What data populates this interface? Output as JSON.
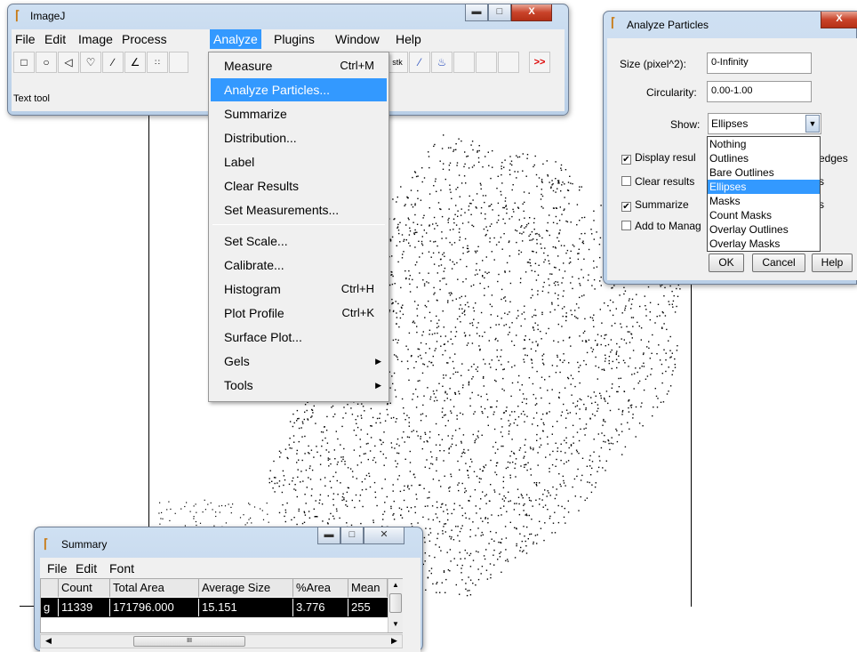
{
  "imagej": {
    "title": "ImageJ",
    "menubar": [
      "File",
      "Edit",
      "Image",
      "Process",
      "Analyze",
      "Plugins",
      "Window",
      "Help"
    ],
    "status": "Text tool",
    "more_tools": ">>"
  },
  "analyze_menu": {
    "items": [
      {
        "label": "Measure",
        "shortcut": "Ctrl+M"
      },
      {
        "label": "Analyze Particles...",
        "shortcut": ""
      },
      {
        "label": "Summarize",
        "shortcut": ""
      },
      {
        "label": "Distribution...",
        "shortcut": ""
      },
      {
        "label": "Label",
        "shortcut": ""
      },
      {
        "label": "Clear Results",
        "shortcut": ""
      },
      {
        "label": "Set Measurements...",
        "shortcut": ""
      },
      {
        "label": "Set Scale...",
        "shortcut": ""
      },
      {
        "label": "Calibrate...",
        "shortcut": ""
      },
      {
        "label": "Histogram",
        "shortcut": "Ctrl+H"
      },
      {
        "label": "Plot Profile",
        "shortcut": "Ctrl+K"
      },
      {
        "label": "Surface Plot...",
        "shortcut": ""
      },
      {
        "label": "Gels",
        "shortcut": ""
      },
      {
        "label": "Tools",
        "shortcut": ""
      }
    ]
  },
  "dialog": {
    "title": "Analyze Particles",
    "size_label": "Size (pixel^2):",
    "size_value": "0-Infinity",
    "circ_label": "Circularity:",
    "circ_value": "0.00-1.00",
    "show_label": "Show:",
    "show_value": "Ellipses",
    "options": [
      "Nothing",
      "Outlines",
      "Bare Outlines",
      "Ellipses",
      "Masks",
      "Count Masks",
      "Overlay Outlines",
      "Overlay Masks"
    ],
    "checks": [
      {
        "label": "Display resul",
        "checked": true
      },
      {
        "label": "Clear results",
        "checked": false
      },
      {
        "label": "Summarize",
        "checked": true
      },
      {
        "label": "Add to Manag",
        "checked": false
      }
    ],
    "right_fragments": [
      "edges",
      "s",
      "s"
    ],
    "ok": "OK",
    "cancel": "Cancel",
    "help": "Help"
  },
  "summary": {
    "title": "Summary",
    "menubar": [
      "File",
      "Edit",
      "Font"
    ],
    "headers": [
      "Count",
      "Total Area",
      "Average Size",
      "%Area",
      "Mean"
    ],
    "row": [
      "11339",
      "171796.000",
      "15.151",
      "3.776",
      "255"
    ],
    "row_stub": "g",
    "scroll_thumb": "III"
  },
  "colors": {
    "selection": "#3399ff",
    "close_red": "#c9432a",
    "title_bar": "#c4d7ec"
  }
}
